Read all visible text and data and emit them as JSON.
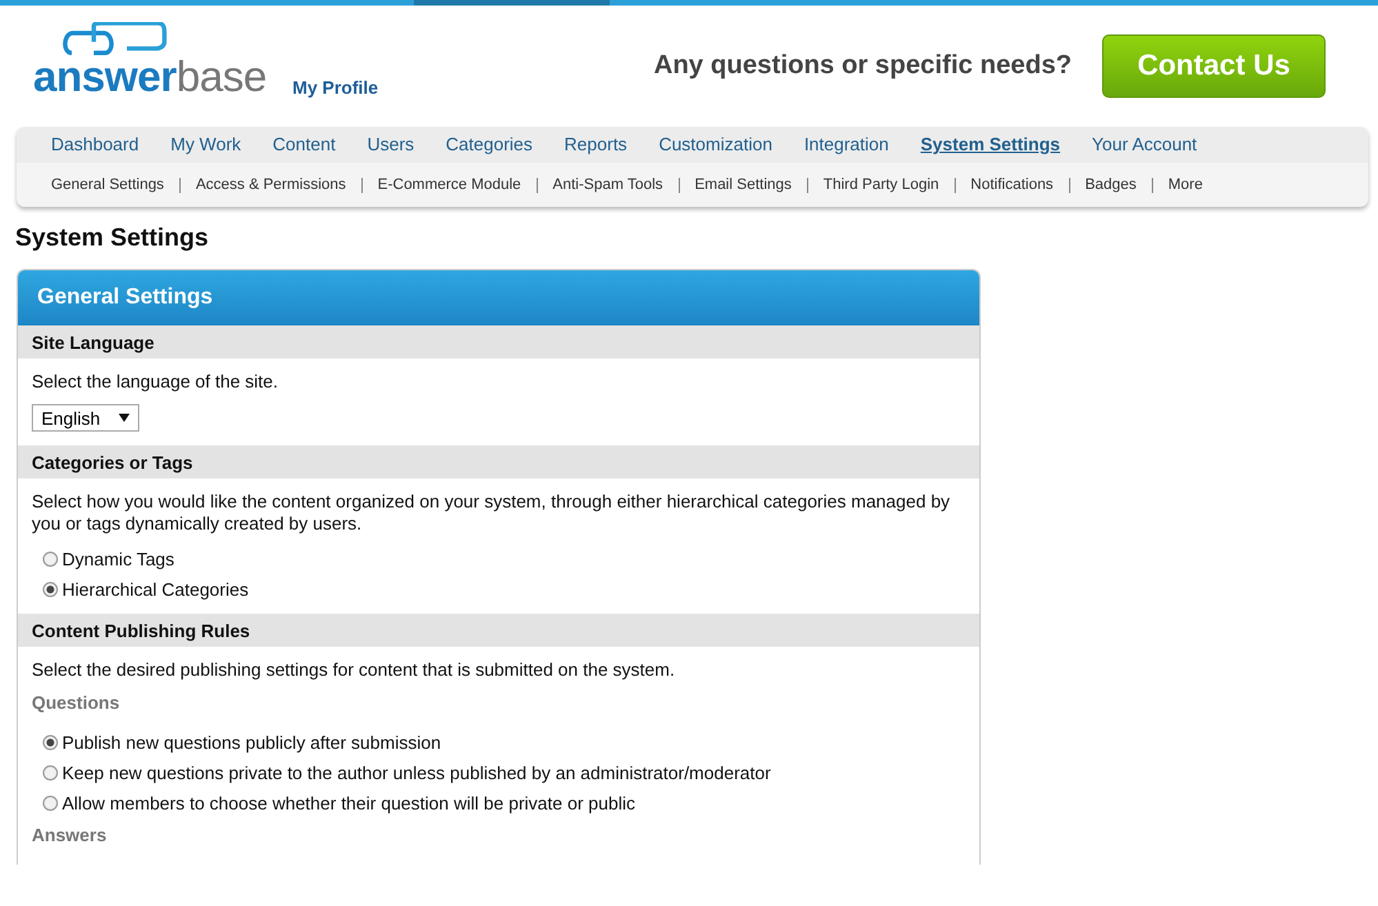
{
  "logo": {
    "first": "answer",
    "second": "base"
  },
  "profile_link": "My Profile",
  "promo": {
    "question": "Any questions or specific needs?",
    "button": "Contact Us"
  },
  "main_nav": [
    {
      "label": "Dashboard",
      "selected": false
    },
    {
      "label": "My Work",
      "selected": false
    },
    {
      "label": "Content",
      "selected": false
    },
    {
      "label": "Users",
      "selected": false
    },
    {
      "label": "Categories",
      "selected": false
    },
    {
      "label": "Reports",
      "selected": false
    },
    {
      "label": "Customization",
      "selected": false
    },
    {
      "label": "Integration",
      "selected": false
    },
    {
      "label": "System Settings",
      "selected": true
    },
    {
      "label": "Your Account",
      "selected": false
    }
  ],
  "sub_nav": [
    "General Settings",
    "Access & Permissions",
    "E-Commerce Module",
    "Anti-Spam Tools",
    "Email Settings",
    "Third Party Login",
    "Notifications",
    "Badges",
    "More"
  ],
  "page_title": "System Settings",
  "panel": {
    "title": "General Settings",
    "sections": [
      {
        "title": "Site Language",
        "blocks": [
          {
            "kind": "text",
            "text": "Select the language of the site."
          },
          {
            "kind": "select",
            "value": "English"
          }
        ]
      },
      {
        "title": "Categories or Tags",
        "blocks": [
          {
            "kind": "text",
            "text": "Select how you would like the content organized on your system, through either hierarchical categories managed by you or tags dynamically created by users."
          },
          {
            "kind": "radios",
            "options": [
              {
                "label": "Dynamic Tags",
                "selected": false
              },
              {
                "label": "Hierarchical Categories",
                "selected": true
              }
            ]
          }
        ]
      },
      {
        "title": "Content Publishing Rules",
        "blocks": [
          {
            "kind": "text",
            "text": "Select the desired publishing settings for content that is submitted on the system."
          },
          {
            "kind": "subheading",
            "text": "Questions"
          },
          {
            "kind": "radios",
            "options": [
              {
                "label": "Publish new questions publicly after submission",
                "selected": true
              },
              {
                "label": "Keep new questions private to the author unless published by an administrator/moderator",
                "selected": false
              },
              {
                "label": "Allow members to choose whether their question will be private or public",
                "selected": false
              }
            ]
          },
          {
            "kind": "subheading",
            "text": "Answers"
          }
        ]
      }
    ]
  }
}
